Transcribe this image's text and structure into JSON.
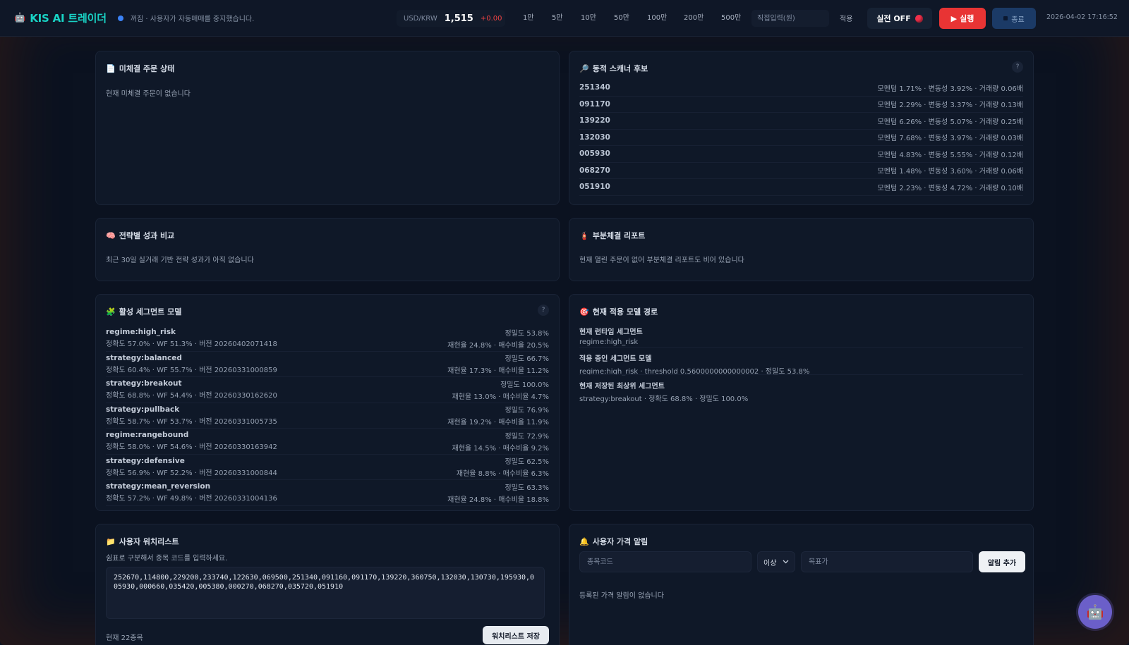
{
  "header": {
    "robot_glyph": "🤖",
    "app_title": "KIS AI 트레이더",
    "status_text": "꺼짐 · 사용자가 자동매매를 중지했습니다.",
    "fx": {
      "label": "USD/KRW",
      "value": "1,515",
      "delta": "+0.00"
    },
    "quick_amounts": [
      "1만",
      "5만",
      "10만",
      "50만",
      "100만",
      "200만",
      "500만"
    ],
    "direct_input_placeholder": "직접입력(원)",
    "apply_label": "적용",
    "live_toggle_label": "실전 OFF",
    "run_label": "실행",
    "run_glyph": "▶",
    "stop_label": "종료",
    "timestamp": "2026-04-02 17:16:52"
  },
  "pending_orders": {
    "icon": "📄",
    "title": "미체결 주문 상태",
    "empty_text": "현재 미체결 주문이 없습니다"
  },
  "scanner": {
    "icon": "🔎",
    "title": "동적 스캐너 후보",
    "help": "?",
    "rows": [
      {
        "code": "251340",
        "metrics": "모멘텀 1.71% · 변동성 3.92% · 거래량 0.06배"
      },
      {
        "code": "091170",
        "metrics": "모멘텀 2.29% · 변동성 3.37% · 거래량 0.13배"
      },
      {
        "code": "139220",
        "metrics": "모멘텀 6.26% · 변동성 5.07% · 거래량 0.25배"
      },
      {
        "code": "132030",
        "metrics": "모멘텀 7.68% · 변동성 3.97% · 거래량 0.03배"
      },
      {
        "code": "005930",
        "metrics": "모멘텀 4.83% · 변동성 5.55% · 거래량 0.12배"
      },
      {
        "code": "068270",
        "metrics": "모멘텀 1.48% · 변동성 3.60% · 거래량 0.06배"
      },
      {
        "code": "051910",
        "metrics": "모멘텀 2.23% · 변동성 4.72% · 거래량 0.10배"
      }
    ]
  },
  "strategy_perf": {
    "icon": "🧠",
    "title": "전략별 성과 비교",
    "empty_text": "최근 30일 실거래 기반 전략 성과가 아직 없습니다"
  },
  "partial_fill": {
    "icon": "🧯",
    "title": "부분체결 리포트",
    "empty_text": "현재 열린 주문이 없어 부분체결 리포트도 비어 있습니다"
  },
  "segments": {
    "icon": "🧩",
    "title": "활성 세그먼트 모델",
    "help": "?",
    "rows": [
      {
        "name": "regime:high_risk",
        "sub": "정확도 57.0% · WF 51.3% · 버전 20260402071418",
        "right1": "정밀도 53.8%",
        "right2": "재현율 24.8% · 매수비율 20.5%"
      },
      {
        "name": "strategy:balanced",
        "sub": "정확도 60.4% · WF 55.7% · 버전 20260331000859",
        "right1": "정밀도 66.7%",
        "right2": "재현율 17.3% · 매수비율 11.2%"
      },
      {
        "name": "strategy:breakout",
        "sub": "정확도 68.8% · WF 54.4% · 버전 20260330162620",
        "right1": "정밀도 100.0%",
        "right2": "재현율 13.0% · 매수비율 4.7%"
      },
      {
        "name": "strategy:pullback",
        "sub": "정확도 58.7% · WF 53.7% · 버전 20260331005735",
        "right1": "정밀도 76.9%",
        "right2": "재현율 19.2% · 매수비율 11.9%"
      },
      {
        "name": "regime:rangebound",
        "sub": "정확도 58.0% · WF 54.6% · 버전 20260330163942",
        "right1": "정밀도 72.9%",
        "right2": "재현율 14.5% · 매수비율 9.2%"
      },
      {
        "name": "strategy:defensive",
        "sub": "정확도 56.9% · WF 52.2% · 버전 20260331000844",
        "right1": "정밀도 62.5%",
        "right2": "재현율 8.8% · 매수비율 6.3%"
      },
      {
        "name": "strategy:mean_reversion",
        "sub": "정확도 57.2% · WF 49.8% · 버전 20260331004136",
        "right1": "정밀도 63.3%",
        "right2": "재현율 24.8% · 매수비율 18.8%"
      }
    ]
  },
  "route": {
    "icon": "🎯",
    "title": "현재 적용 모델 경로",
    "blocks": [
      {
        "head": "현재 런타임 세그먼트",
        "body": "regime:high_risk"
      },
      {
        "head": "적용 중인 세그먼트 모델",
        "body": "regime:high_risk · threshold 0.5600000000000002 · 정밀도 53.8%"
      },
      {
        "head": "현재 저장된 최상위 세그먼트",
        "body": "strategy:breakout · 정확도 68.8% · 정밀도 100.0%"
      }
    ]
  },
  "watchlist": {
    "icon": "📁",
    "title": "사용자 워치리스트",
    "hint": "쉼표로 구분해서 종목 코드를 입력하세요.",
    "value": "252670,114800,229200,233740,122630,069500,251340,091160,091170,139220,360750,132030,130730,195930,005930,000660,035420,005380,000270,068270,035720,051910",
    "count_text": "현재 22종목",
    "save_label": "워치리스트 저장"
  },
  "alerts": {
    "icon": "🔔",
    "title": "사용자 가격 알림",
    "code_placeholder": "종목코드",
    "condition_value": "이상",
    "target_placeholder": "목표가",
    "add_label": "알림 추가",
    "empty_text": "등록된 가격 알림이 없습니다"
  },
  "assistant": {
    "glyph": "🤖"
  },
  "colors": {
    "brand": "#19d3c5",
    "run": "#e83434",
    "stop": "#1b3a66",
    "status_dot": "#3b82f6",
    "delta_negative": "#ef4444"
  }
}
